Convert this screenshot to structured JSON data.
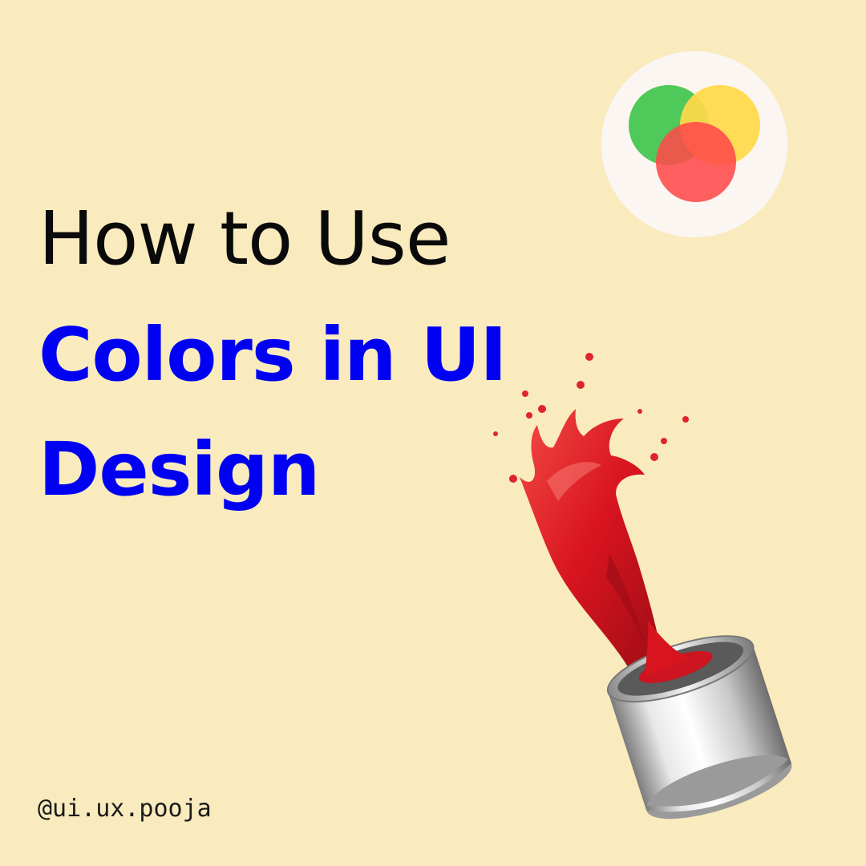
{
  "headline": {
    "line1": "How to Use",
    "line2": "Colors in UI",
    "line3": "Design"
  },
  "handle": "@ui.ux.pooja",
  "colors": {
    "background": "#f9ebbe",
    "headline_dark": "#0a0a0a",
    "headline_accent": "#0000f2",
    "logo_badge": "#fcf6f2",
    "logo_green": "#4fc95a",
    "logo_yellow": "#ffd84a",
    "logo_red": "#ff4a4a",
    "paint_red": "#e01e2b"
  },
  "icons": {
    "logo": "color-circles-logo-icon",
    "illustration": "paint-can-splash-icon"
  }
}
